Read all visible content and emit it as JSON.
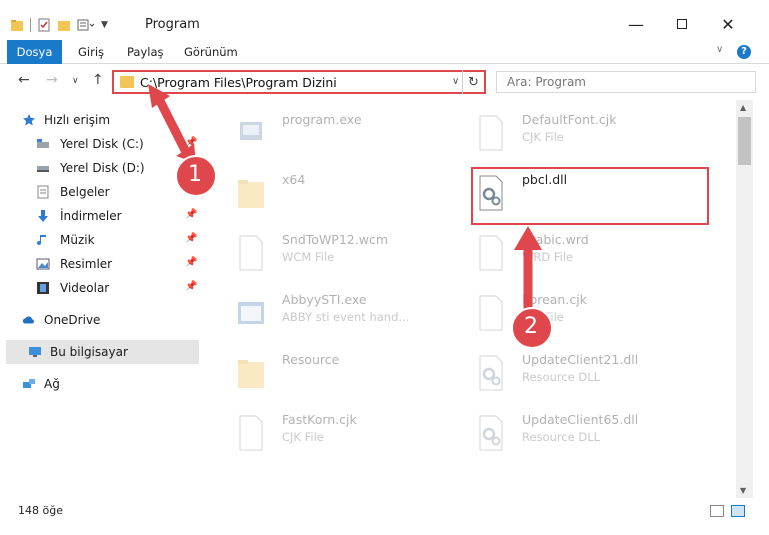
{
  "window": {
    "title": "Program"
  },
  "ribbon": {
    "tabs": [
      {
        "label": "Dosya"
      },
      {
        "label": "Giriş"
      },
      {
        "label": "Paylaş"
      },
      {
        "label": "Görünüm"
      }
    ]
  },
  "navbar": {
    "address": "C:\\Program Files\\Program Dizini",
    "search_placeholder": "Ara: Program"
  },
  "sidebar": {
    "items": [
      {
        "label": "Hızlı erişim",
        "icon": "star-icon",
        "pinned": false
      },
      {
        "label": "Yerel Disk (C:)",
        "icon": "drive-icon",
        "pinned": true
      },
      {
        "label": "Yerel Disk (D:)",
        "icon": "drive-icon",
        "pinned": true
      },
      {
        "label": "Belgeler",
        "icon": "documents-icon",
        "pinned": true
      },
      {
        "label": "İndirmeler",
        "icon": "download-icon",
        "pinned": true
      },
      {
        "label": "Müzik",
        "icon": "music-icon",
        "pinned": true
      },
      {
        "label": "Resimler",
        "icon": "pictures-icon",
        "pinned": true
      },
      {
        "label": "Videolar",
        "icon": "videos-icon",
        "pinned": true
      },
      {
        "label": "OneDrive",
        "icon": "cloud-icon",
        "pinned": false
      },
      {
        "label": "Bu bilgisayar",
        "icon": "computer-icon",
        "pinned": false,
        "selected": true
      },
      {
        "label": "Ağ",
        "icon": "network-icon",
        "pinned": false
      }
    ]
  },
  "files": [
    {
      "name": "program.exe",
      "type": "",
      "kind": "exe"
    },
    {
      "name": "DefaultFont.cjk",
      "type": "CJK File",
      "kind": "doc"
    },
    {
      "name": "x64",
      "type": "",
      "kind": "folder"
    },
    {
      "name": "pbcl.dll",
      "type": "",
      "kind": "dll",
      "highlighted": true
    },
    {
      "name": "SndToWP12.wcm",
      "type": "WCM File",
      "kind": "doc"
    },
    {
      "name": "Arabic.wrd",
      "type": "WRD File",
      "kind": "doc"
    },
    {
      "name": "AbbyySTI.exe",
      "type": "ABBY sti event hand...",
      "kind": "app"
    },
    {
      "name": "Korean.cjk",
      "type": "CJK File",
      "kind": "doc"
    },
    {
      "name": "Resource",
      "type": "",
      "kind": "folder"
    },
    {
      "name": "UpdateClient21.dll",
      "type": "Resource DLL",
      "kind": "dll"
    },
    {
      "name": "FastKorn.cjk",
      "type": "CJK File",
      "kind": "doc"
    },
    {
      "name": "UpdateClient65.dll",
      "type": "Resource DLL",
      "kind": "dll"
    }
  ],
  "status": {
    "count": "148 öğe"
  },
  "annotations": [
    {
      "label": "1"
    },
    {
      "label": "2"
    }
  ],
  "colors": {
    "accent": "#1979ca",
    "annotation": "#e0474c",
    "folder": "#f3c456"
  }
}
